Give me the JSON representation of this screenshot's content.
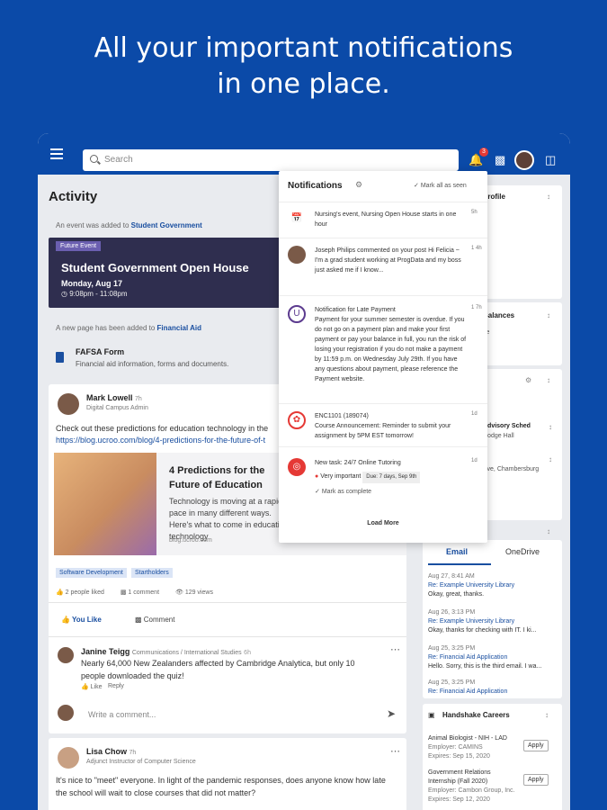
{
  "headline": {
    "line1": "All your important notifications",
    "line2": "in one place."
  },
  "topbar": {
    "search_placeholder": "Search",
    "notification_count": "3"
  },
  "feed": {
    "title": "Activity",
    "event_note_prefix": "An event was added to ",
    "event_note_link": "Student Government",
    "event": {
      "tag": "Future Event",
      "title": "Student Government Open House",
      "date": "Monday, Aug 17",
      "time": "9:08pm - 11:08pm"
    },
    "page_note_prefix": "A new page has been added to ",
    "page_note_link": "Financial Aid",
    "page": {
      "title": "FAFSA Form",
      "subtitle": "Financial aid information, forms and documents."
    },
    "post1": {
      "author": "Mark Lowell",
      "time": "7h",
      "role": "Digital Campus Admin",
      "text": "Check out these predictions for education technology in the",
      "link": "https://blog.ucroo.com/blog/4-predictions-for-the-future-of-t",
      "card_title": "4 Predictions for the Future of Education",
      "card_desc": "Technology is moving at a rapid pace in many different ways. Here's what to come in education technology",
      "card_url": "blog.ucroo.com",
      "tags": [
        "Software Development",
        "Startholders"
      ],
      "likes": "2 people liked",
      "comments": "1 comment",
      "views": "129 views",
      "like_label": "You Like",
      "comment_label": "Comment",
      "reply": {
        "author": "Janine Teigg",
        "role": "Communications / International Studies",
        "time": "6h",
        "text": "Nearly 64,000 New Zealanders affected by Cambridge Analytica, but only 10 people downloaded the quiz!",
        "like": "Like",
        "reply": "Reply"
      },
      "input_placeholder": "Write a comment..."
    },
    "post2": {
      "author": "Lisa Chow",
      "time": "7h",
      "role": "Adjunct Instructor of Computer Science",
      "text": "It's nice to \"meet\" everyone. In light of the pandemic responses, does anyone know how late the school will wait to close courses that did not matter?"
    }
  },
  "notifications": {
    "title": "Notifications",
    "mark_all": "Mark all as seen",
    "items": [
      {
        "text": "Nursing's event, Nursing Open House starts in one hour",
        "time": "5h"
      },
      {
        "text": "Joseph Philips commented on your post Hi Felicia ~ I'm a grad student working at ProgData and my boss just asked me if I know...",
        "time": "1 4h"
      },
      {
        "text": "Notification for Late Payment\nPayment for your summer semester is overdue. If you do not go on a payment plan and make your first payment or pay your balance in full, you run the risk of losing your registration if you do not make a payment by 11:59 p.m. on Wednesday July 29th. If you have any questions about payment, please reference the Payment website.",
        "time": "1 7h"
      },
      {
        "text": "ENC1101 (189074)\nCourse Announcement: Reminder to submit your assignment by 5PM EST tomorrow!",
        "time": "1d"
      },
      {
        "text": "New task: 24/7 Online Tutoring",
        "time": "1d",
        "priority": "Very important",
        "due": "Due: 7 days, Sep 9th",
        "mark": "Mark as complete"
      }
    ],
    "load_more": "Load More"
  },
  "widgets": {
    "profile_title": "Profile",
    "balances_title": "Balances",
    "balances_sub": "ce",
    "schedule_line1": "Advisory Sched",
    "schedule_line2": "Dodge Hall",
    "schedule_line3": "Ave, Chambersburg",
    "email_tab": "Email",
    "onedrive_tab": "OneDrive",
    "emails": [
      {
        "date": "Aug 27, 8:41 AM",
        "subject": "Re: Example University Library",
        "preview": "Okay, great, thanks."
      },
      {
        "date": "Aug 26, 3:13 PM",
        "subject": "Re: Example University Library",
        "preview": "Okay, thanks for checking with IT. I ki..."
      },
      {
        "date": "Aug 25, 3:25 PM",
        "subject": "Re: Financial Aid Application",
        "preview": "Hello. Sorry, this is the third email. I wa..."
      },
      {
        "date": "Aug 25, 3:25 PM",
        "subject": "Re: Financial Aid Application",
        "preview": ""
      }
    ],
    "careers_title": "Handshake Careers",
    "jobs": [
      {
        "title": "Animal Biologist - NIH - LAD",
        "employer": "Employer: CAMINS",
        "expires": "Expires: Sep 15, 2020",
        "apply": "Apply"
      },
      {
        "title": "Government Relations Internship (Fall 2020)",
        "employer": "Employer: Cambon Group, Inc.",
        "expires": "Expires: Sep 12, 2020",
        "apply": "Apply"
      }
    ]
  }
}
